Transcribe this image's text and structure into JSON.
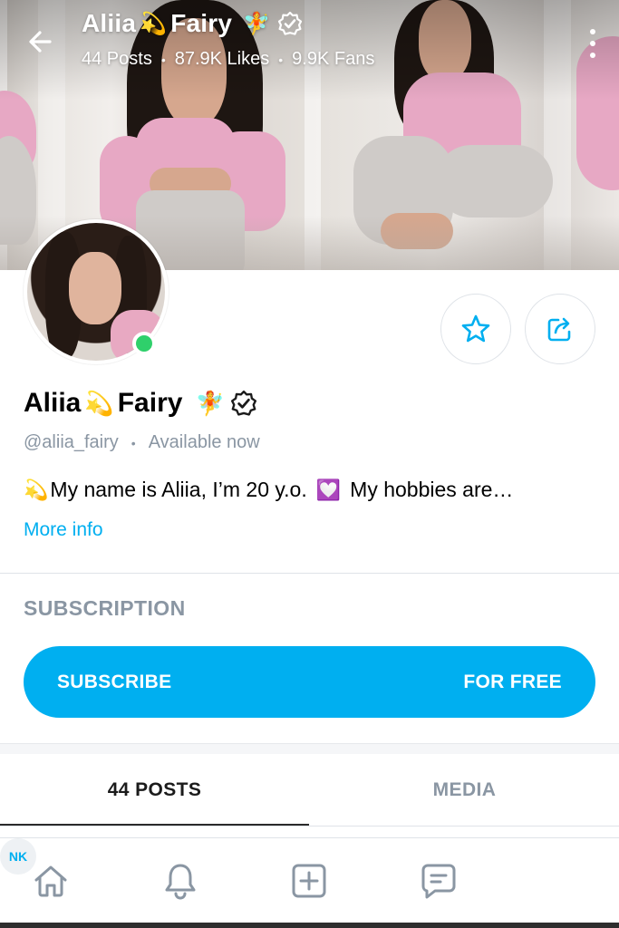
{
  "header": {
    "name_part1": "Aliia",
    "name_emoji1": "💫",
    "name_part2": "Fairy",
    "name_emoji2": "🧚",
    "stats": {
      "posts": "44 Posts",
      "likes": "87.9K Likes",
      "fans": "9.9K Fans"
    }
  },
  "profile": {
    "name_part1": "Aliia",
    "name_emoji1": "💫",
    "name_part2": "Fairy",
    "name_emoji2": "🧚",
    "handle": "@aliia_fairy",
    "availability": "Available now",
    "bio_emoji1": "💫",
    "bio_text1": "My name is Aliia, I’m 20 y.o.",
    "bio_emoji2": "💟",
    "bio_text2": "My hobbies are…",
    "more_info": "More info",
    "online": true
  },
  "subscription": {
    "section_label": "SUBSCRIPTION",
    "button_label": "SUBSCRIBE",
    "price_label": "FOR FREE"
  },
  "tabs": [
    {
      "label": "44 POSTS",
      "active": true
    },
    {
      "label": "MEDIA",
      "active": false
    }
  ],
  "bottom_nav": {
    "items": [
      "home-icon",
      "bell-icon",
      "add-post-icon",
      "messages-icon"
    ],
    "user_initials": "NK"
  },
  "colors": {
    "accent": "#00aff0",
    "muted_text": "#8a96a3",
    "online": "#2fd06b",
    "divider": "#dfe3e8"
  }
}
